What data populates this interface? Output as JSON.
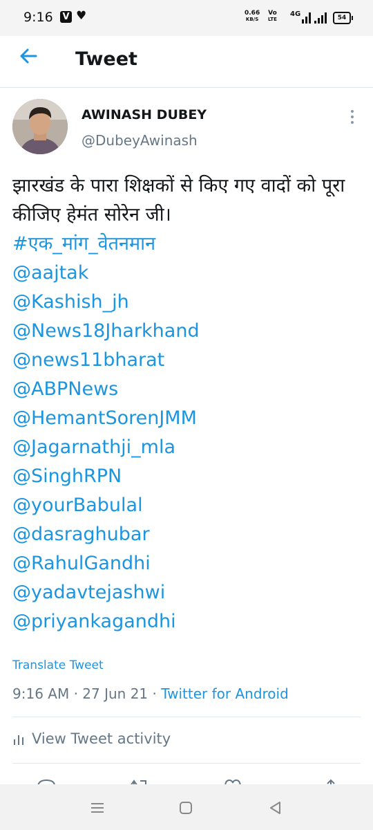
{
  "status_bar": {
    "time": "9:16",
    "app_icon_letter": "V",
    "net_speed_value": "0.66",
    "net_speed_unit": "KB/S",
    "volte_top": "Vo",
    "volte_bottom": "LTE",
    "network_type": "4G",
    "battery_level": "54"
  },
  "header": {
    "title": "Tweet"
  },
  "tweet": {
    "author_name": "AWINASH DUBEY",
    "author_handle": "@DubeyAwinash",
    "text": "झारखंड के पारा शिक्षकों से किए गए वादों को पूरा कीजिए हेमंत सोरेन जी।",
    "links": [
      "#एक_मांग_वेतनमान",
      "@aajtak",
      "@Kashish_jh",
      "@News18Jharkhand",
      "@news11bharat",
      "@ABPNews",
      "@HemantSorenJMM",
      "@Jagarnathji_mla",
      "@SinghRPN",
      "@yourBabulal",
      "@dasraghubar",
      "@RahulGandhi",
      "@yadavtejashwi",
      "@priyankagandhi"
    ],
    "translate_label": "Translate Tweet",
    "time_date": "9:16 AM · 27 Jun 21 · ",
    "source": "Twitter for Android",
    "activity_label": "View Tweet activity"
  },
  "colors": {
    "link": "#1b95e0",
    "secondary_text": "#657786",
    "primary_text": "#14171a"
  }
}
